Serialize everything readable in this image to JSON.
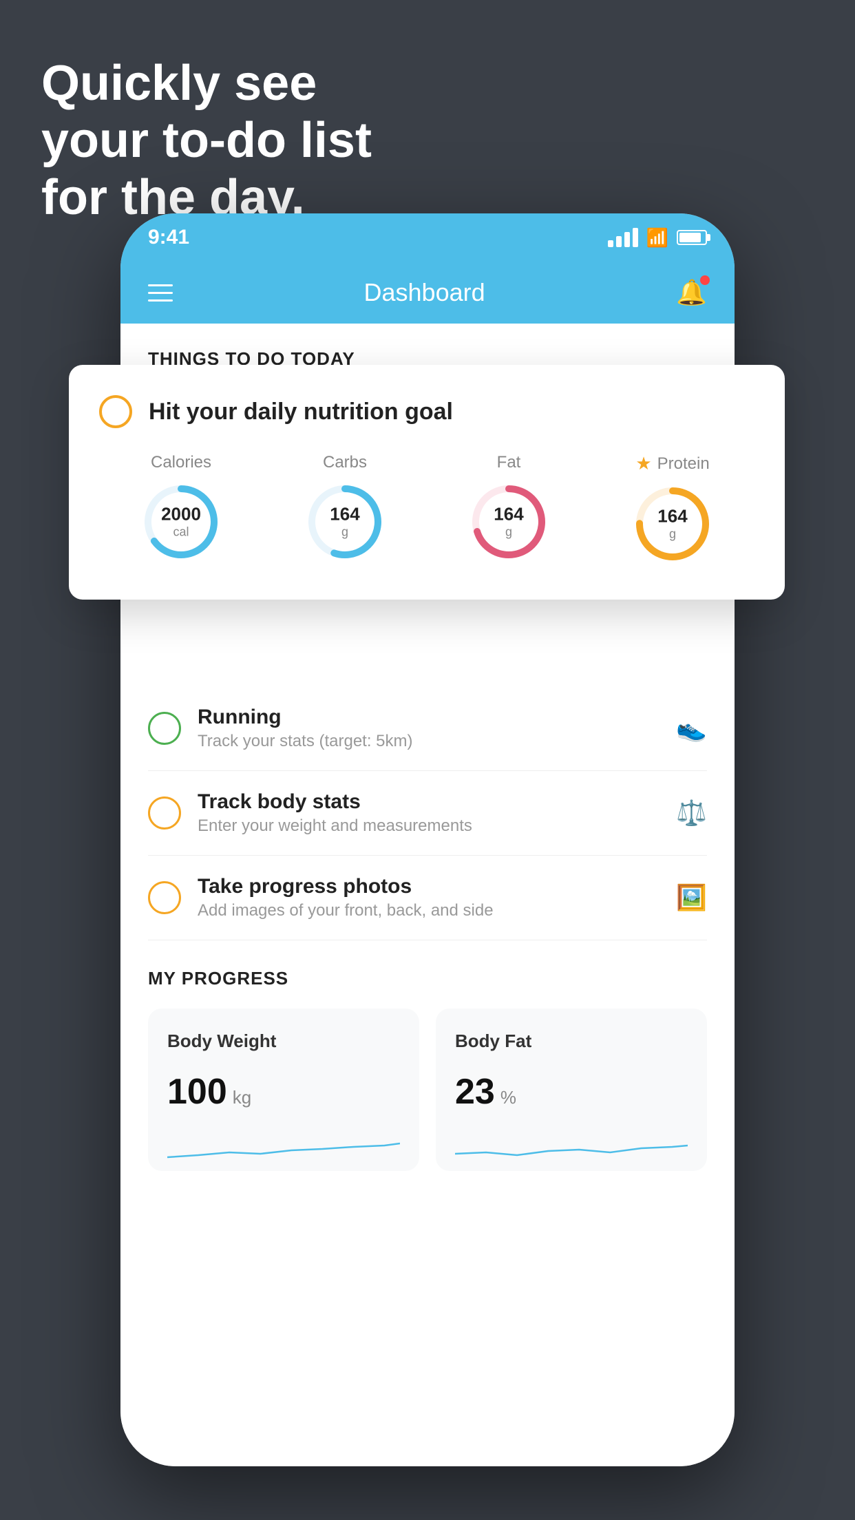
{
  "headline": {
    "line1": "Quickly see",
    "line2": "your to-do list",
    "line3": "for the day."
  },
  "phone": {
    "status_bar": {
      "time": "9:41"
    },
    "nav": {
      "title": "Dashboard"
    }
  },
  "things_section": {
    "label": "THINGS TO DO TODAY"
  },
  "nutrition_card": {
    "circle_icon": "circle-empty",
    "title": "Hit your daily nutrition goal",
    "items": [
      {
        "label": "Calories",
        "value": "2000",
        "unit": "cal",
        "color": "#4dbde8",
        "percent": 65
      },
      {
        "label": "Carbs",
        "value": "164",
        "unit": "g",
        "color": "#4dbde8",
        "percent": 55
      },
      {
        "label": "Fat",
        "value": "164",
        "unit": "g",
        "color": "#e05a7a",
        "percent": 70
      },
      {
        "label": "Protein",
        "value": "164",
        "unit": "g",
        "color": "#f5a623",
        "percent": 75,
        "starred": true
      }
    ]
  },
  "todo_items": [
    {
      "id": "running",
      "title": "Running",
      "subtitle": "Track your stats (target: 5km)",
      "status": "green",
      "icon": "shoe-icon"
    },
    {
      "id": "track-body-stats",
      "title": "Track body stats",
      "subtitle": "Enter your weight and measurements",
      "status": "yellow",
      "icon": "scale-icon"
    },
    {
      "id": "progress-photos",
      "title": "Take progress photos",
      "subtitle": "Add images of your front, back, and side",
      "status": "yellow",
      "icon": "portrait-icon"
    }
  ],
  "progress_section": {
    "label": "MY PROGRESS",
    "cards": [
      {
        "title": "Body Weight",
        "value": "100",
        "unit": "kg"
      },
      {
        "title": "Body Fat",
        "value": "23",
        "unit": "%"
      }
    ]
  }
}
